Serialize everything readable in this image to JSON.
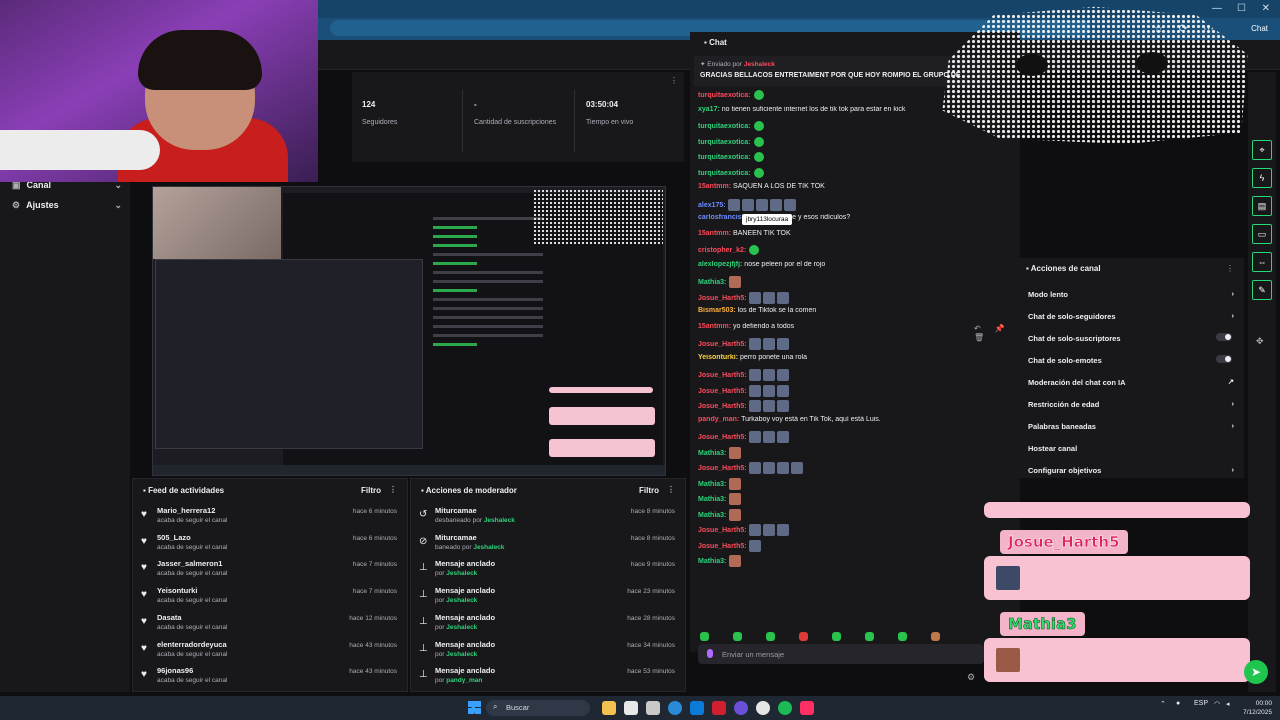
{
  "browser": {
    "tab_label": "Chat"
  },
  "nav": [
    {
      "label": "Canal",
      "icon": "video-icon"
    },
    {
      "label": "Ajustes",
      "icon": "gear-icon"
    }
  ],
  "stats": [
    {
      "value": "124",
      "label": "Seguidores"
    },
    {
      "value": "-",
      "label": "Cantidad de suscripciones"
    },
    {
      "value": "03:50:04",
      "label": "Tiempo en vivo"
    }
  ],
  "activity_feed": {
    "title": "Feed de actividades",
    "filter_label": "Filtro",
    "items": [
      {
        "name": "Mario_herrera12",
        "sub": "acaba de seguir el canal",
        "time": "hace 6 minutos"
      },
      {
        "name": "505_Lazo",
        "sub": "acaba de seguir el canal",
        "time": "hace 6 minutos"
      },
      {
        "name": "Jasser_salmeron1",
        "sub": "acaba de seguir el canal",
        "time": "hace 7 minutos"
      },
      {
        "name": "Yeisonturki",
        "sub": "acaba de seguir el canal",
        "time": "hace 7 minutos"
      },
      {
        "name": "Dasata",
        "sub": "acaba de seguir el canal",
        "time": "hace 12 minutos"
      },
      {
        "name": "elenterradordeyuca",
        "sub": "acaba de seguir el canal",
        "time": "hace 43 minutos"
      },
      {
        "name": "96jonas96",
        "sub": "acaba de seguir el canal",
        "time": "hace 43 minutos"
      }
    ]
  },
  "mod_actions": {
    "title": "Acciones de moderador",
    "filter_label": "Filtro",
    "items": [
      {
        "name": "Miturcamae",
        "sub": "desbaneado por",
        "by": "Jeshaleck",
        "time": "hace 8 minutos",
        "icon": "undo-icon"
      },
      {
        "name": "Miturcamae",
        "sub": "baneado por",
        "by": "Jeshaleck",
        "time": "hace 8 minutos",
        "icon": "ban-icon"
      },
      {
        "name": "Mensaje anclado",
        "sub": "por",
        "by": "Jeshaleck",
        "time": "hace 9 minutos",
        "icon": "pin-icon"
      },
      {
        "name": "Mensaje anclado",
        "sub": "por",
        "by": "Jeshaleck",
        "time": "hace 23 minutos",
        "icon": "pin-icon"
      },
      {
        "name": "Mensaje anclado",
        "sub": "por",
        "by": "Jeshaleck",
        "time": "hace 28 minutos",
        "icon": "pin-icon"
      },
      {
        "name": "Mensaje anclado",
        "sub": "por",
        "by": "Jeshaleck",
        "time": "hace 34 minutos",
        "icon": "pin-icon"
      },
      {
        "name": "Mensaje anclado",
        "sub": "por",
        "by": "pandy_man",
        "time": "hace 53 minutos",
        "icon": "pin-icon"
      }
    ]
  },
  "chat": {
    "title": "Chat",
    "pinned_prefix": "Enviado por",
    "pinned_user": "Jeshaleck",
    "pinned_text": "GRACIAS BELLACOS ENTRETAIMENT POR QUE HOY ROMPIO EL GRUPO DE",
    "tooltip": "jbry113locuraa",
    "input_placeholder": "Enviar un mensaje",
    "messages": [
      {
        "user": "turquitaexotica:",
        "text": "",
        "color": "#ff4a5a",
        "emotes": "g"
      },
      {
        "user": "xya17:",
        "text": "no tienen suficiente internet los de tik tok para estar en kick",
        "color": "#2ed37a",
        "emotes": ""
      },
      {
        "user": "turquitaexotica:",
        "text": "",
        "color": "#2ed37a",
        "emotes": "g"
      },
      {
        "user": "turquitaexotica:",
        "text": "",
        "color": "#2ed37a",
        "emotes": "g"
      },
      {
        "user": "turquitaexotica:",
        "text": "",
        "color": "#2ed37a",
        "emotes": "g"
      },
      {
        "user": "turquitaexotica:",
        "text": "",
        "color": "#2ed37a",
        "emotes": "g"
      },
      {
        "user": "15antmm:",
        "text": "SAQUEN A LOS DE TIK TOK",
        "color": "#ff4a5a",
        "emotes": ""
      },
      {
        "user": "alex175:",
        "text": "",
        "color": "#6b8cff",
        "emotes": "sssss"
      },
      {
        "user": "carlosfranciscoarteaga24:",
        "text": "Oe y esos ridículos?",
        "color": "#6b8cff",
        "emotes": ""
      },
      {
        "user": "15antmm:",
        "text": "BANEEN TIK TOK",
        "color": "#ff4a5a",
        "emotes": ""
      },
      {
        "user": "cristopher_k2:",
        "text": "",
        "color": "#ff4a5a",
        "emotes": "g"
      },
      {
        "user": "alexlopezjfjfj:",
        "text": "nose peleen por el de rojo",
        "color": "#2ed37a",
        "emotes": ""
      },
      {
        "user": "Mathia3:",
        "text": "",
        "color": "#2ed37a",
        "emotes": "f"
      },
      {
        "user": "Josue_Harth5:",
        "text": "",
        "color": "#ff4a5a",
        "emotes": "sss"
      },
      {
        "user": "Bismar503:",
        "text": "los de Tiktok se la comen",
        "color": "#ffb23e",
        "emotes": ""
      },
      {
        "user": "15antmm:",
        "text": "yo defiendo a todos",
        "color": "#ff4a5a",
        "emotes": ""
      },
      {
        "user": "Josue_Harth5:",
        "text": "",
        "color": "#ff4a5a",
        "emotes": "sss"
      },
      {
        "user": "Yeisonturki:",
        "text": "perro ponete una rola",
        "color": "#ffd23e",
        "emotes": ""
      },
      {
        "user": "Josue_Harth5:",
        "text": "",
        "color": "#ff4a5a",
        "emotes": "sss"
      },
      {
        "user": "Josue_Harth5:",
        "text": "",
        "color": "#ff4a5a",
        "emotes": "sss"
      },
      {
        "user": "Josue_Harth5:",
        "text": "",
        "color": "#ff4a5a",
        "emotes": "sss"
      },
      {
        "user": "pandy_man:",
        "text": "Turkaboy voy está en Tik Tok, aquí está Luis.",
        "color": "#ff4a5a",
        "emotes": ""
      },
      {
        "user": "Josue_Harth5:",
        "text": "",
        "color": "#ff4a5a",
        "emotes": "sss"
      },
      {
        "user": "Mathia3:",
        "text": "",
        "color": "#2ed37a",
        "emotes": "f"
      },
      {
        "user": "Josue_Harth5:",
        "text": "",
        "color": "#ff4a5a",
        "emotes": "ssss"
      },
      {
        "user": "Mathia3:",
        "text": "",
        "color": "#2ed37a",
        "emotes": "f"
      },
      {
        "user": "Mathia3:",
        "text": "",
        "color": "#2ed37a",
        "emotes": "f"
      },
      {
        "user": "Mathia3:",
        "text": "",
        "color": "#2ed37a",
        "emotes": "f"
      },
      {
        "user": "Josue_Harth5:",
        "text": "",
        "color": "#ff4a5a",
        "emotes": "sss"
      },
      {
        "user": "Josue_Harth5:",
        "text": "",
        "color": "#ff4a5a",
        "emotes": "s"
      },
      {
        "user": "Mathia3:",
        "text": "",
        "color": "#2ed37a",
        "emotes": "f"
      }
    ]
  },
  "channel_actions": {
    "title": "Acciones de canal",
    "items": [
      {
        "label": "Modo lento",
        "control": "chevron"
      },
      {
        "label": "Chat de solo-seguidores",
        "control": "chevron"
      },
      {
        "label": "Chat de solo-suscriptores",
        "control": "toggle"
      },
      {
        "label": "Chat de solo-emotes",
        "control": "toggle"
      },
      {
        "label": "Moderación del chat con IA",
        "control": "external"
      },
      {
        "label": "Restricción de edad",
        "control": "chevron"
      },
      {
        "label": "Palabras baneadas",
        "control": "chevron"
      },
      {
        "label": "Hostear canal",
        "control": ""
      },
      {
        "label": "Configurar objetivos",
        "control": "chevron"
      }
    ]
  },
  "alerts": [
    {
      "name": "Josue_Harth5"
    },
    {
      "name": "Mathia3"
    }
  ],
  "taskbar": {
    "search": "Buscar",
    "lang": "ESP",
    "time": "00:00",
    "date": "7/12/2025"
  }
}
